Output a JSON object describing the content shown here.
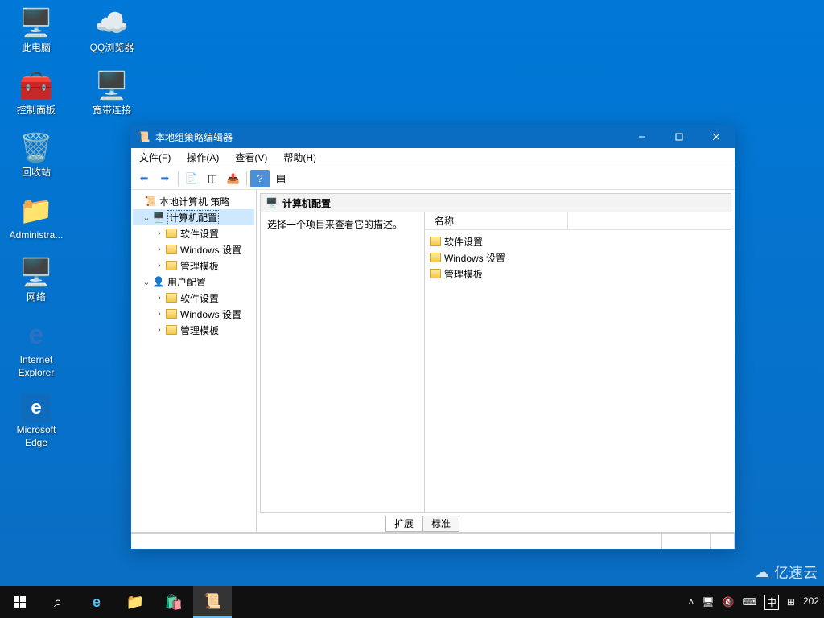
{
  "desktop": {
    "icons": [
      {
        "name": "此电脑",
        "glyph": "🖥️"
      },
      {
        "name": "QQ浏览器",
        "glyph": "🌐"
      },
      {
        "name": "控制面板",
        "glyph": "🧰"
      },
      {
        "name": "宽带连接",
        "glyph": "🔗"
      },
      {
        "name": "回收站",
        "glyph": "🗑️"
      },
      {
        "name": "Administra...",
        "glyph": "📁"
      },
      {
        "name": "网络",
        "glyph": "🖧"
      },
      {
        "name": "Internet Explorer",
        "glyph": "🌐"
      },
      {
        "name": "Microsoft Edge",
        "glyph": "e"
      }
    ]
  },
  "window": {
    "title": "本地组策略编辑器",
    "menu": {
      "file": "文件(F)",
      "action": "操作(A)",
      "view": "查看(V)",
      "help": "帮助(H)"
    }
  },
  "tree": {
    "root": "本地计算机 策略",
    "computer": "计算机配置",
    "user": "用户配置",
    "soft": "软件设置",
    "windows": "Windows 设置",
    "admin": "管理模板"
  },
  "content": {
    "header": "计算机配置",
    "desc": "选择一个项目来查看它的描述。",
    "colName": "名称",
    "items": [
      {
        "label": "软件设置"
      },
      {
        "label": "Windows 设置"
      },
      {
        "label": "管理模板"
      }
    ],
    "tabs": {
      "extended": "扩展",
      "standard": "标准"
    }
  },
  "tray": {
    "ime": "中",
    "date": "202"
  },
  "watermark": "亿速云"
}
